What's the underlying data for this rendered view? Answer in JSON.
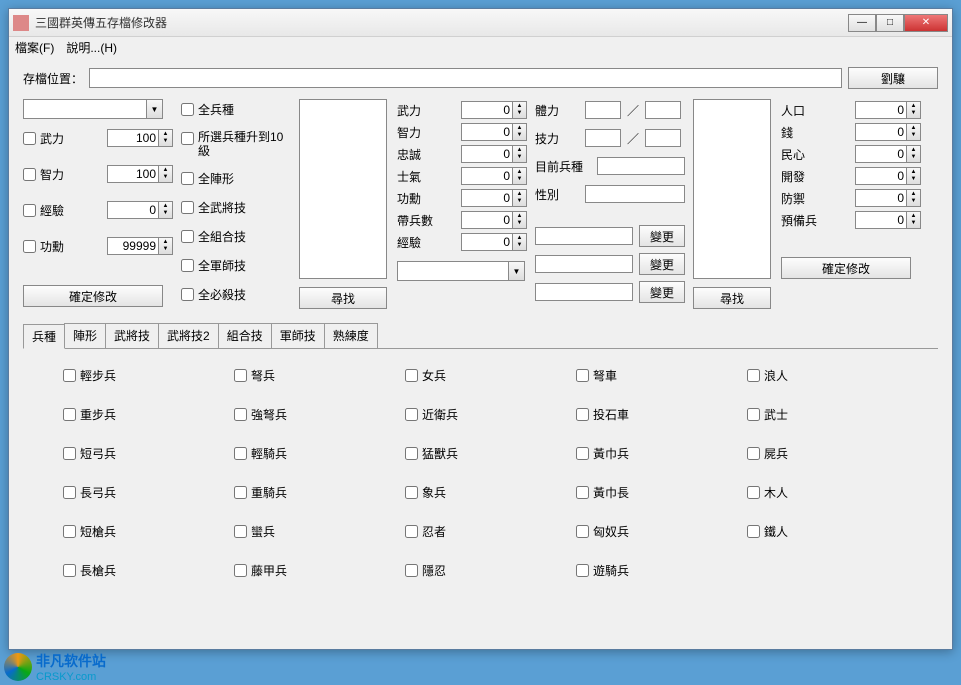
{
  "window": {
    "title": "三國群英傳五存檔修改器"
  },
  "menu": {
    "file": "檔案(F)",
    "help": "說明...(H)"
  },
  "savePath": {
    "label": "存檔位置：",
    "value": "",
    "browse": "劉驤"
  },
  "left": {
    "combo": "",
    "rows": [
      {
        "label": "武力",
        "value": "100"
      },
      {
        "label": "智力",
        "value": "100"
      },
      {
        "label": "經驗",
        "value": "0"
      },
      {
        "label": "功勳",
        "value": "99999"
      }
    ],
    "confirm": "確定修改"
  },
  "leftChecks": {
    "allTypes": "全兵種",
    "upgrade": "所選兵種升到10級",
    "allForm": "全陣形",
    "allMartial": "全武將技",
    "allCombo": "全組合技",
    "allArmy": "全軍師技",
    "allKill": "全必殺技"
  },
  "mid": {
    "stats": [
      {
        "label": "武力",
        "value": "0"
      },
      {
        "label": "智力",
        "value": "0"
      },
      {
        "label": "忠誠",
        "value": "0"
      },
      {
        "label": "士氣",
        "value": "0"
      },
      {
        "label": "功勳",
        "value": "0"
      },
      {
        "label": "帶兵數",
        "value": "0"
      },
      {
        "label": "經驗",
        "value": "0"
      }
    ],
    "search": "尋找"
  },
  "mid2": {
    "phys": "體力",
    "skill": "技力",
    "slash": "／",
    "curUnit": "目前兵種",
    "gender": "性別",
    "change": "變更"
  },
  "city": {
    "stats": [
      {
        "label": "人口",
        "value": "0"
      },
      {
        "label": "錢",
        "value": "0"
      },
      {
        "label": "民心",
        "value": "0"
      },
      {
        "label": "開發",
        "value": "0"
      },
      {
        "label": "防禦",
        "value": "0"
      },
      {
        "label": "預備兵",
        "value": "0"
      }
    ],
    "search": "尋找",
    "confirm": "確定修改"
  },
  "tabs": [
    "兵種",
    "陣形",
    "武將技",
    "武將技2",
    "組合技",
    "軍師技",
    "熟練度"
  ],
  "units": [
    [
      "輕步兵",
      "弩兵",
      "女兵",
      "弩車",
      "浪人"
    ],
    [
      "重步兵",
      "強弩兵",
      "近衛兵",
      "投石車",
      "武士"
    ],
    [
      "短弓兵",
      "輕騎兵",
      "猛獸兵",
      "黃巾兵",
      "屍兵"
    ],
    [
      "長弓兵",
      "重騎兵",
      "象兵",
      "黃巾長",
      "木人"
    ],
    [
      "短槍兵",
      "蠻兵",
      "忍者",
      "匈奴兵",
      "鐵人"
    ],
    [
      "長槍兵",
      "藤甲兵",
      "隱忍",
      "遊騎兵",
      ""
    ]
  ],
  "watermark": {
    "line1": "非凡软件站",
    "line2": "CRSKY.com"
  }
}
